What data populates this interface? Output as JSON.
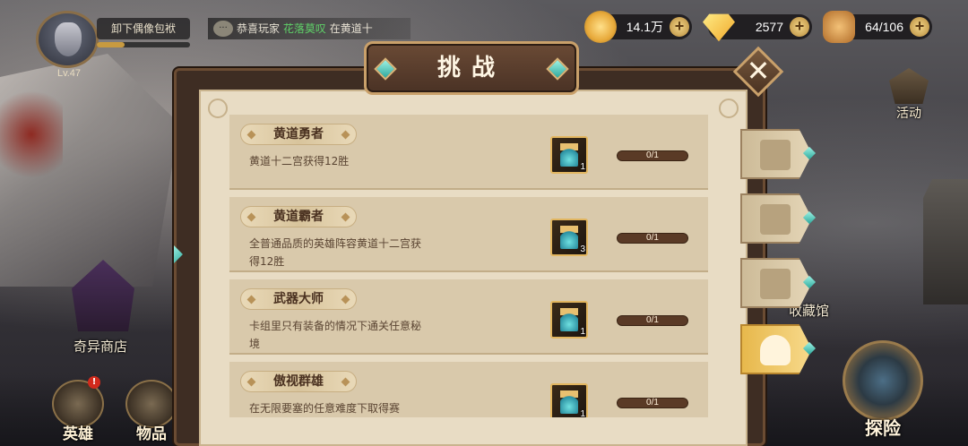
{
  "player": {
    "level": "Lv.47",
    "unload_label": "卸下偶像包袱"
  },
  "announcement": {
    "prefix": "恭喜玩家",
    "name": "花落莫叹",
    "suffix": "在黄道十"
  },
  "currencies": {
    "gold": "14.1万",
    "gems": "2577",
    "stamina": "64/106"
  },
  "side_menu": {
    "event_label": "活动",
    "collection_label": "收藏馆",
    "explore_label": "探险",
    "shop_label": "奇异商店",
    "hero_label": "英雄",
    "items_label": "物品",
    "hero_badge": "!"
  },
  "modal": {
    "title": "挑战",
    "close_symbol": "✕",
    "tasks": [
      {
        "name": "黄道勇者",
        "desc": "黄道十二宫获得12胜",
        "reward_count": "1",
        "progress": "0/1"
      },
      {
        "name": "黄道霸者",
        "desc": "全普通品质的英雄阵容黄道十二宫获得12胜",
        "reward_count": "3",
        "progress": "0/1"
      },
      {
        "name": "武器大师",
        "desc": "卡组里只有装备的情况下通关任意秘境",
        "reward_count": "1",
        "progress": "0/1"
      },
      {
        "name": "傲视群雄",
        "desc": "在无限要塞的任意难度下取得赛",
        "reward_count": "1",
        "progress": "0/1"
      }
    ],
    "tabs": [
      {
        "icon": "scroll-icon"
      },
      {
        "icon": "book-icon"
      },
      {
        "icon": "crossed-swords-icon"
      },
      {
        "icon": "trophy-icon"
      }
    ]
  },
  "colors": {
    "highlight_name": "#5fd068",
    "active_tab": "#e7b84c",
    "paper": "#e8dcc4",
    "frame": "#3e2d23"
  }
}
